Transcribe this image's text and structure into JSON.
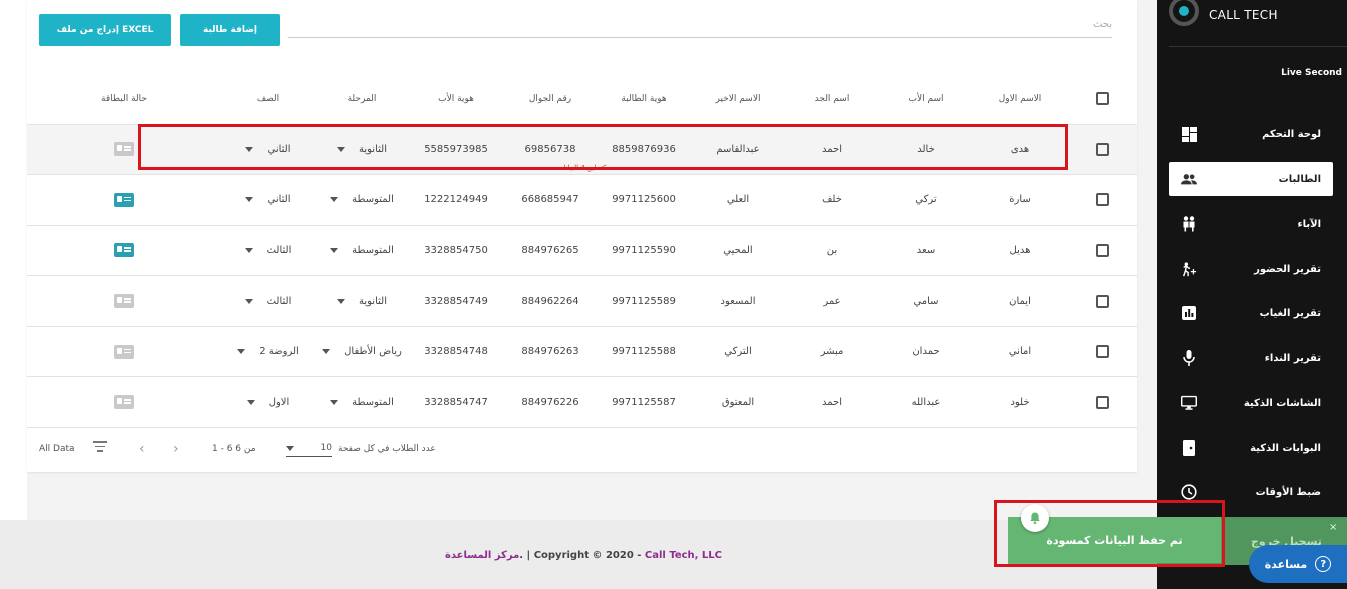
{
  "toolbar": {
    "excel_button": "إدراج من ملف EXCEL",
    "add_button": "إضافة طالبة",
    "search_placeholder": "بحث"
  },
  "table": {
    "columns": [
      "الاسم الاول",
      "اسم الأب",
      "اسم الجد",
      "الاسم الاخير",
      "هوية الطالبة",
      "رقم الجوال",
      "هوية الأب",
      "المرحلة",
      "الصف",
      "حالة البطاقة"
    ],
    "rows": [
      {
        "first": "هدى",
        "father": "خالد",
        "grand": "احمد",
        "last": "عبدالقاسم",
        "student_id": "8859876936",
        "mobile": "69856738",
        "father_id": "5585973985",
        "stage": "الثانوية",
        "grade": "الثاني",
        "card": "gray"
      },
      {
        "first": "سارة",
        "father": "تركي",
        "grand": "خلف",
        "last": "العلي",
        "student_id": "9971125600",
        "mobile": "668685947",
        "father_id": "1222124949",
        "stage": "المتوسطة",
        "grade": "الثاني",
        "card": "teal"
      },
      {
        "first": "هديل",
        "father": "سعد",
        "grand": "بن",
        "last": "المحيي",
        "student_id": "9971125590",
        "mobile": "884976265",
        "father_id": "3328854750",
        "stage": "المتوسطة",
        "grade": "الثالث",
        "card": "teal"
      },
      {
        "first": "ايمان",
        "father": "سامي",
        "grand": "عمر",
        "last": "المسعود",
        "student_id": "9971125589",
        "mobile": "884962264",
        "father_id": "3328854749",
        "stage": "الثانوية",
        "grade": "الثالث",
        "card": "gray"
      },
      {
        "first": "اماني",
        "father": "حمدان",
        "grand": "مبشر",
        "last": "التركي",
        "student_id": "9971125588",
        "mobile": "884976263",
        "father_id": "3328854748",
        "stage": "رياض الأطفال",
        "grade": "الروضة 2",
        "card": "gray"
      },
      {
        "first": "خلود",
        "father": "عبدالله",
        "grand": "احمد",
        "last": "المعتوق",
        "student_id": "9971125587",
        "mobile": "884976226",
        "father_id": "3328854747",
        "stage": "المتوسطة",
        "grade": "الاول",
        "card": "gray"
      }
    ],
    "hint": "مكتملين 4 البيانات"
  },
  "pagination": {
    "all_data": "All Data",
    "range": "1 - 6 من 6",
    "per_page_value": "10",
    "per_page_label": "عدد الطلاب في كل صفحة"
  },
  "footer": {
    "copyright": "Copyright © 2020 - ",
    "brand": "Call Tech, LLC",
    "separator": ". | ",
    "help_link": "مركز المساعدة"
  },
  "sidebar": {
    "logo": "CALL TECH",
    "user": "Live Second",
    "items": [
      {
        "label": "لوحة التحكم",
        "icon": "dashboard-icon"
      },
      {
        "label": "الطالبات",
        "icon": "people-icon"
      },
      {
        "label": "الآباء",
        "icon": "family-icon"
      },
      {
        "label": "تقرير الحضور",
        "icon": "attendance-icon"
      },
      {
        "label": "تقرير الغياب",
        "icon": "report-icon"
      },
      {
        "label": "تقرير النداء",
        "icon": "microphone-icon"
      },
      {
        "label": "الشاشات الذكية",
        "icon": "monitor-icon"
      },
      {
        "label": "البوابات الذكية",
        "icon": "gate-icon"
      },
      {
        "label": "ضبط الأوقات",
        "icon": "clock-icon"
      }
    ],
    "active_index": 1
  },
  "toast": {
    "back_text": "تسجيل خروج",
    "message": "تم حفظ البيانات كمسودة",
    "close": "×"
  },
  "help_button": "مساعدة",
  "colors": {
    "accent": "#1fb3c8",
    "sidebar": "#141414",
    "toast": "#65b673",
    "highlight": "#d8141c",
    "help": "#1e6fbf",
    "footer_brand": "#8e2d8e"
  }
}
